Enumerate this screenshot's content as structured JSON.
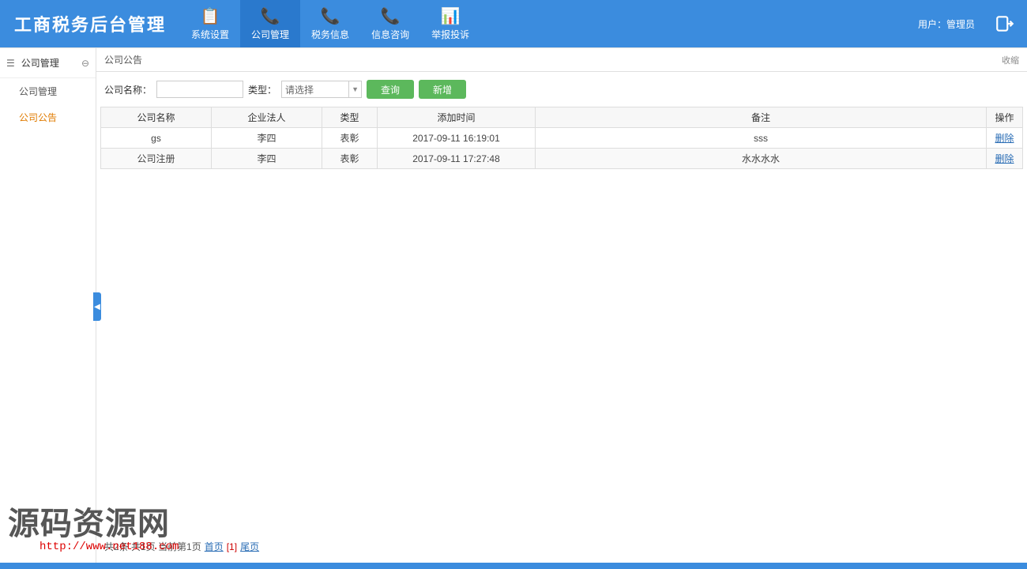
{
  "header": {
    "logo": "工商税务后台管理",
    "nav": [
      {
        "label": "系统设置",
        "icon": "📋"
      },
      {
        "label": "公司管理",
        "icon": "📞"
      },
      {
        "label": "税务信息",
        "icon": "📞"
      },
      {
        "label": "信息咨询",
        "icon": "📞"
      },
      {
        "label": "举报投诉",
        "icon": "📊"
      }
    ],
    "user_label": "用户：管理员"
  },
  "sidebar": {
    "title": "公司管理",
    "items": [
      {
        "label": "公司管理"
      },
      {
        "label": "公司公告"
      }
    ]
  },
  "breadcrumb": {
    "title": "公司公告",
    "collapse": "收缩"
  },
  "filter": {
    "name_label": "公司名称：",
    "name_value": "",
    "type_label": "类型：",
    "type_placeholder": "请选择",
    "search_btn": "查询",
    "new_btn": "新增"
  },
  "table": {
    "headers": {
      "name": "公司名称",
      "legal": "企业法人",
      "type": "类型",
      "time": "添加时间",
      "remark": "备注",
      "action": "操作"
    },
    "rows": [
      {
        "name": "gs",
        "legal": "李四",
        "type": "表彰",
        "time": "2017-09-11 16:19:01",
        "remark": "sss",
        "action": "删除"
      },
      {
        "name": "公司注册",
        "legal": "李四",
        "type": "表彰",
        "time": "2017-09-11 17:27:48",
        "remark": "水水水水",
        "action": "删除"
      }
    ]
  },
  "pager": {
    "summary": "共2条 共1页 当前第1页",
    "first": "首页",
    "current": "[1]",
    "last": "尾页"
  },
  "watermark": {
    "title": "源码资源网",
    "url": "http://www.net188.com"
  }
}
